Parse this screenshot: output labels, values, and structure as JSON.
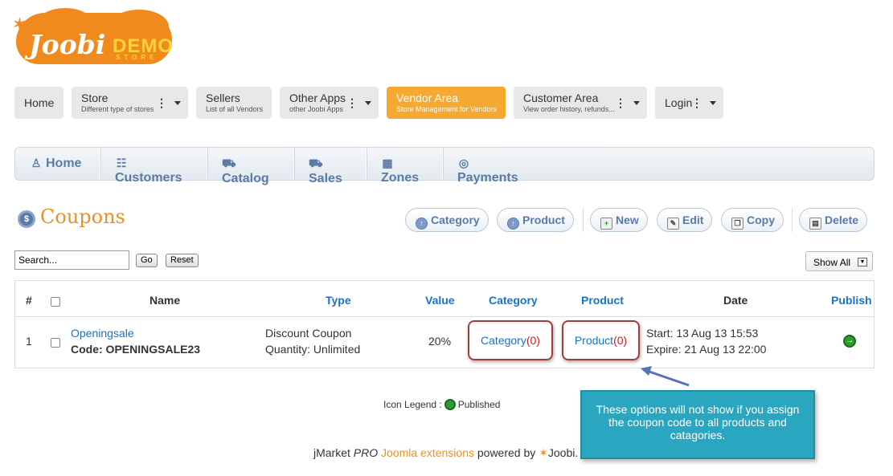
{
  "logo": {
    "spark": "✶",
    "name": "Joobi",
    "demo": "DEMO",
    "store": "STORE"
  },
  "top_menu": [
    {
      "title": "Home",
      "subtitle": ""
    },
    {
      "title": "Store",
      "subtitle": "Different type of stores",
      "dropdown": true
    },
    {
      "title": "Sellers",
      "subtitle": "List of all Vendors"
    },
    {
      "title": "Other Apps",
      "subtitle": "other Joobi Apps",
      "dropdown": true
    },
    {
      "title": "Vendor Area",
      "subtitle": "Store Management for Vendors",
      "active": true
    },
    {
      "title": "Customer Area",
      "subtitle": "View order history, refunds...",
      "dropdown": true
    },
    {
      "title": "Login",
      "subtitle": "",
      "dropdown": true
    }
  ],
  "vendor_nav": [
    {
      "label": "Home",
      "icon": "person-icon"
    },
    {
      "label": "Customers",
      "icon": "users-icon"
    },
    {
      "label": "Catalog",
      "icon": "cart-icon"
    },
    {
      "label": "Sales",
      "icon": "truck-icon"
    },
    {
      "label": "Zones",
      "icon": "calendar-icon"
    },
    {
      "label": "Payments",
      "icon": "coin-icon"
    }
  ],
  "page": {
    "title": "Coupons"
  },
  "toolbar": {
    "category": "Category",
    "product": "Product",
    "new": "New",
    "edit": "Edit",
    "copy": "Copy",
    "delete": "Delete"
  },
  "search": {
    "value": "Search...",
    "go": "Go",
    "reset": "Reset",
    "filter": "Show All"
  },
  "table": {
    "headers": {
      "num": "#",
      "name": "Name",
      "type": "Type",
      "value": "Value",
      "category": "Category",
      "product": "Product",
      "date": "Date",
      "publish": "Publish"
    },
    "rows": [
      {
        "num": "1",
        "name": "Openingsale",
        "code": "Code: OPENINGSALE23",
        "type": "Discount Coupon",
        "quantity": "Quantity: Unlimited",
        "value": "20%",
        "category_label": "Category",
        "category_count": "(0)",
        "product_label": "Product",
        "product_count": "(0)",
        "start": "Start: 13 Aug 13 15:53",
        "expire": "Expire: 21 Aug 13 22:00",
        "published": true
      }
    ]
  },
  "callout": "These options will not show if you assign the coupon code to all products and catagories.",
  "legend": {
    "label": "Icon Legend :",
    "published": "Published"
  },
  "footer": {
    "brand": "jMarket",
    "pro": "PRO",
    "ext": "Joomla extensions",
    "powered": "powered by",
    "joobi": "Joobi."
  },
  "colors": {
    "accent": "#f5a832",
    "link": "#1a73c8",
    "nav": "#5a7ba8",
    "callout": "#2aa6c0",
    "highlight": "#a33c3c"
  }
}
